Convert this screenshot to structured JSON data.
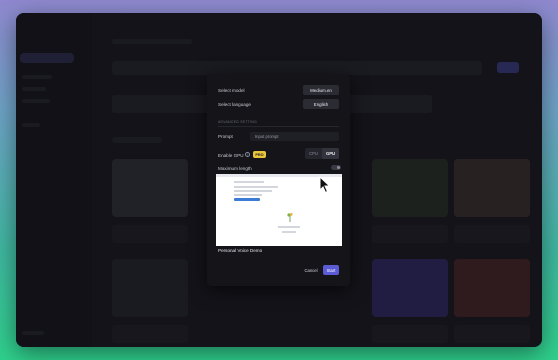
{
  "modal": {
    "select_model_label": "Select model",
    "select_model_value": "Medium.en",
    "select_language_label": "Select language",
    "select_language_value": "English",
    "advanced_setting_label": "ADVANCED SETTING",
    "prompt_label": "Prompt",
    "prompt_placeholder": "Input prompt",
    "enable_gpu_label": "Enable GPU",
    "pro_badge": "PRO",
    "device_options": [
      "CPU",
      "GPU"
    ],
    "device_selected": "GPU",
    "maximum_length_label": "Maximum length",
    "preview_caption": "Personal Voice Demo",
    "cancel_label": "Cancel",
    "start_label": "Start"
  },
  "colors": {
    "accent": "#5b5bd6",
    "pro_badge": "#e8c53a",
    "window_bg": "#1b1b22"
  },
  "icons": [
    "info-icon",
    "mouse-cursor-icon"
  ]
}
